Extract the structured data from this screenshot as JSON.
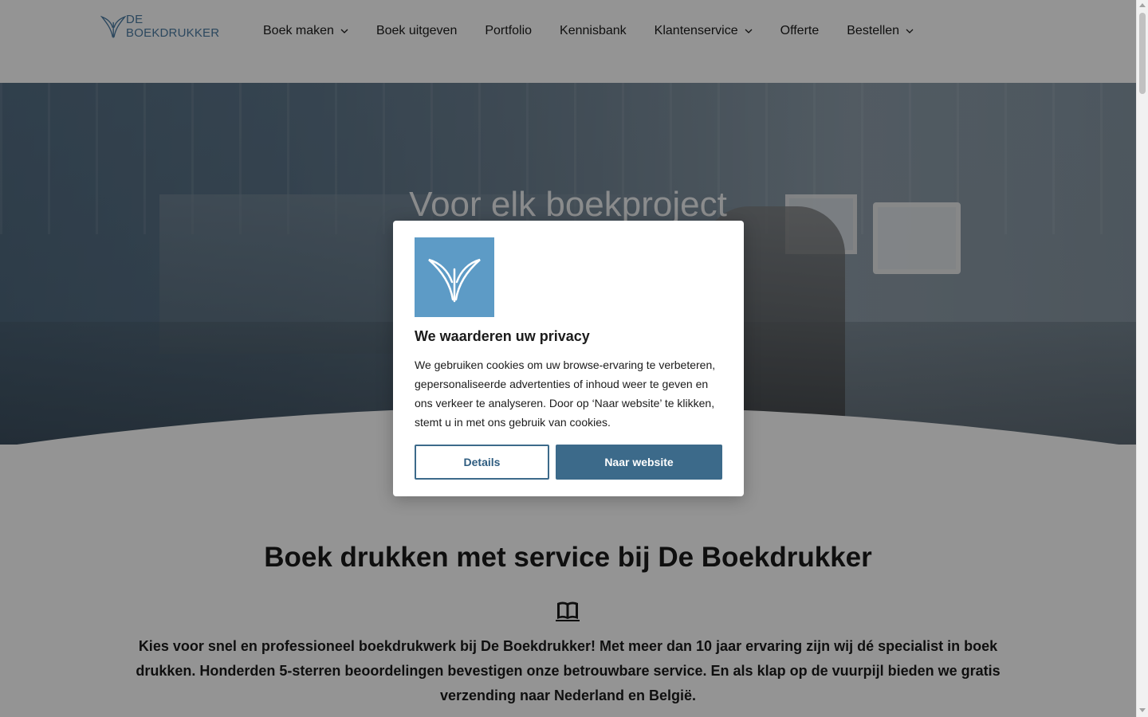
{
  "header": {
    "logo_text": "DE BOEKDRUKKER",
    "nav": [
      {
        "label": "Boek maken",
        "has_dropdown": true
      },
      {
        "label": "Boek uitgeven",
        "has_dropdown": false
      },
      {
        "label": "Portfolio",
        "has_dropdown": false
      },
      {
        "label": "Kennisbank",
        "has_dropdown": false
      },
      {
        "label": "Klantenservice",
        "has_dropdown": true
      },
      {
        "label": "Offerte",
        "has_dropdown": false
      },
      {
        "label": "Bestellen",
        "has_dropdown": true
      }
    ]
  },
  "hero": {
    "title": "Voor elk boekproject"
  },
  "main": {
    "section_title": "Boek drukken met service bij De Boekdrukker",
    "intro": "Kies voor snel en professioneel boekdrukwerk bij De Boekdrukker! Met meer dan 10 jaar ervaring zijn wij dé specialist in boek drukken. Honderden 5-sterren beoordelingen bevestigen onze betrouwbare service. En als klap op de vuurpijl bieden we gratis verzending naar Nederland en België."
  },
  "cookie_dialog": {
    "title": "We waarderen uw privacy",
    "text": "We gebruiken cookies om uw browse-ervaring te verbeteren, gepersonaliseerde advertenties of inhoud weer te geven en ons verkeer te analyseren. Door op ‘Naar website’ te klikken, stemt u in met ons gebruik van cookies.",
    "details_label": "Details",
    "accept_label": "Naar website"
  },
  "colors": {
    "brand_blue": "#5d9bc6",
    "button_blue": "#3c6a8a",
    "logo_text": "#4a7ba3"
  },
  "icons": [
    "logo-icon",
    "chevron-down-icon",
    "book-icon"
  ]
}
